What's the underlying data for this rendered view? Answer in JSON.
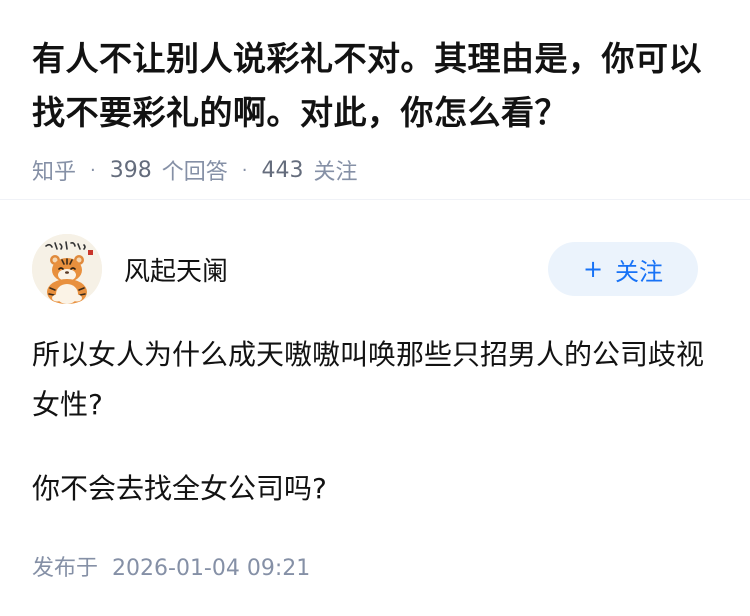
{
  "question": {
    "title": "有人不让别人说彩礼不对。其理由是，你可以找不要彩礼的啊。对此，你怎么看？",
    "source": "知乎",
    "answer_count": "398",
    "answer_label": "个回答",
    "follower_count": "443",
    "follower_label": "关注"
  },
  "author": {
    "name": "风起天阑",
    "avatar_icon": "tiger-cartoon-avatar",
    "follow_label": "关注"
  },
  "answer": {
    "paragraph1": "所以女人为什么成天嗷嗷叫唤那些只招男人的公司歧视女性?",
    "paragraph2": "你不会去找全女公司吗?"
  },
  "publish": {
    "label": "发布于",
    "time": "2026-01-04 09:21"
  },
  "colors": {
    "text": "#121212",
    "meta": "#8590a6",
    "accent": "#1772f6",
    "follow_bg": "#ebf3fc",
    "divider": "#f0f2f7"
  }
}
